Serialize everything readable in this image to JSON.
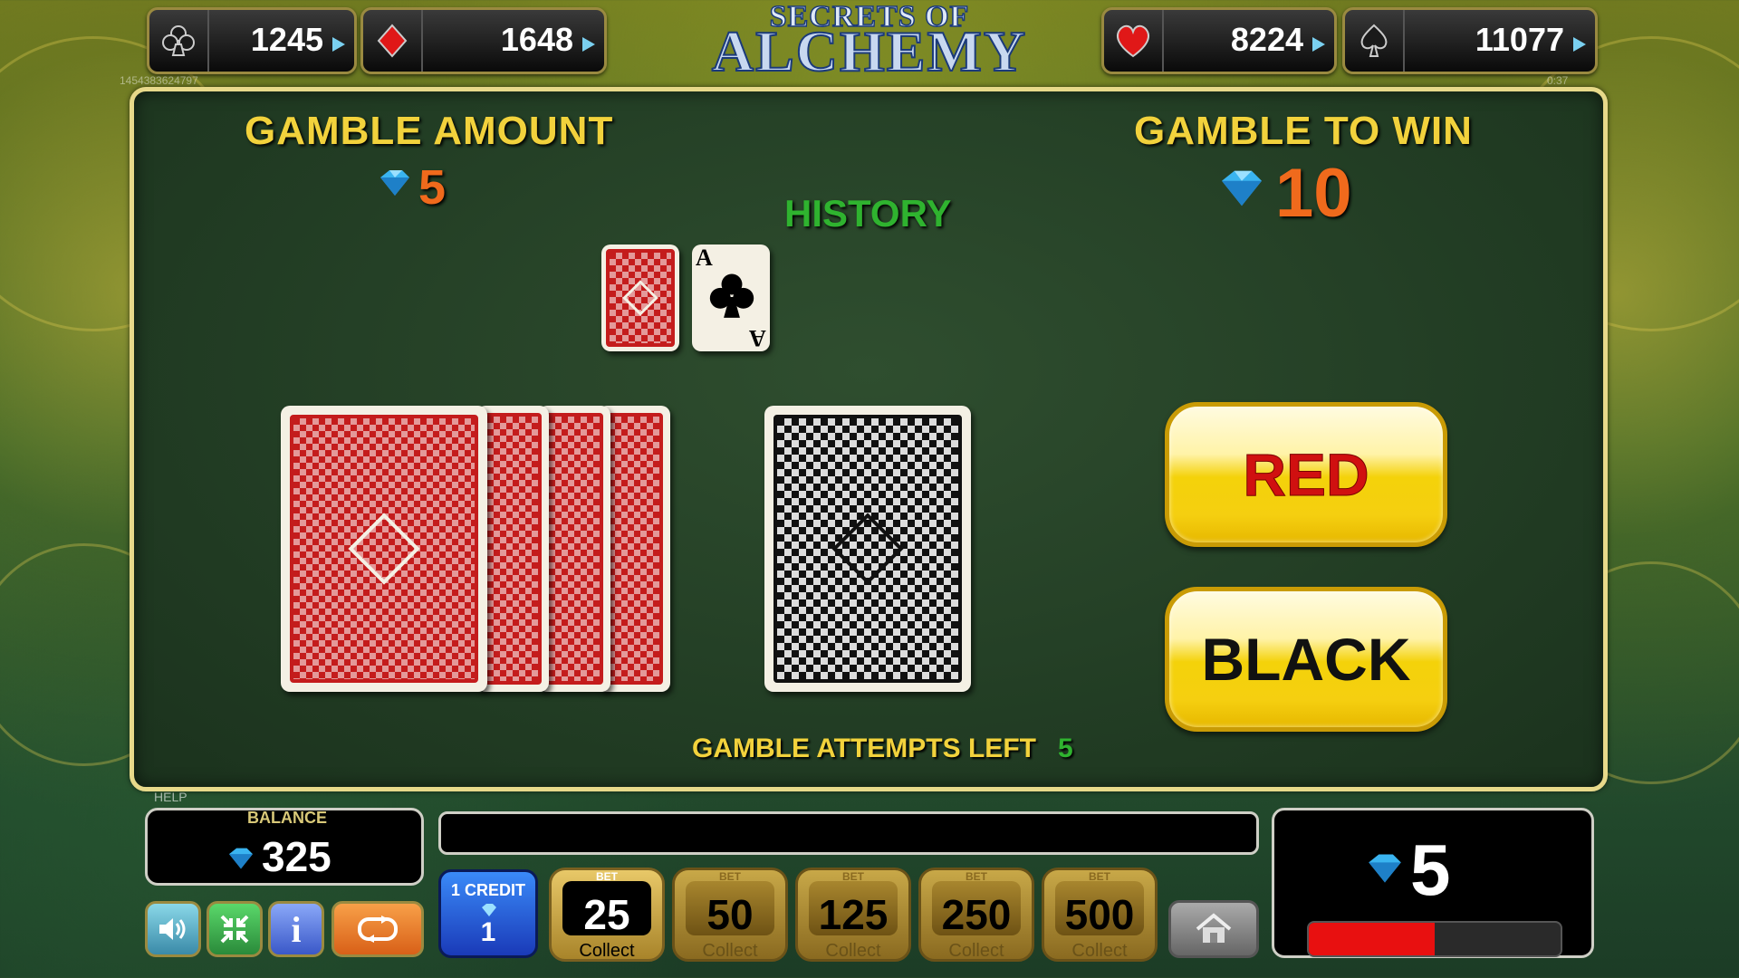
{
  "jackpots": [
    {
      "suit": "club-icon",
      "value": "1245"
    },
    {
      "suit": "diamond-suit-icon",
      "value": "1648"
    },
    {
      "suit": "heart-icon",
      "value": "8224"
    },
    {
      "suit": "spade-icon",
      "value": "11077"
    }
  ],
  "session_id": "1454383624797",
  "clock": "0:37",
  "logo": {
    "line1": "SECRETS OF",
    "line2": "ALCHEMY"
  },
  "gamble": {
    "amount_label": "GAMBLE AMOUNT",
    "amount_value": "5",
    "to_win_label": "GAMBLE TO WIN",
    "to_win_value": "10",
    "history_label": "HISTORY",
    "history_ace": "A",
    "red_button": "RED",
    "black_button": "BLACK",
    "attempts_label": "GAMBLE ATTEMPTS LEFT",
    "attempts_value": "5"
  },
  "bottom": {
    "help_label": "HELP",
    "balance_label": "BALANCE",
    "balance_value": "325",
    "credit_label": "1 CREDIT",
    "credit_value": "1",
    "bet_label": "BET",
    "collect_label": "Collect",
    "bets": [
      "25",
      "50",
      "125",
      "250",
      "500"
    ],
    "win_value": "5",
    "win_progress": 0.5
  },
  "colors": {
    "gold": "#f2d23c",
    "orange": "#f06a1c",
    "green": "#2fb32f",
    "red_button_text": "#d01010"
  }
}
